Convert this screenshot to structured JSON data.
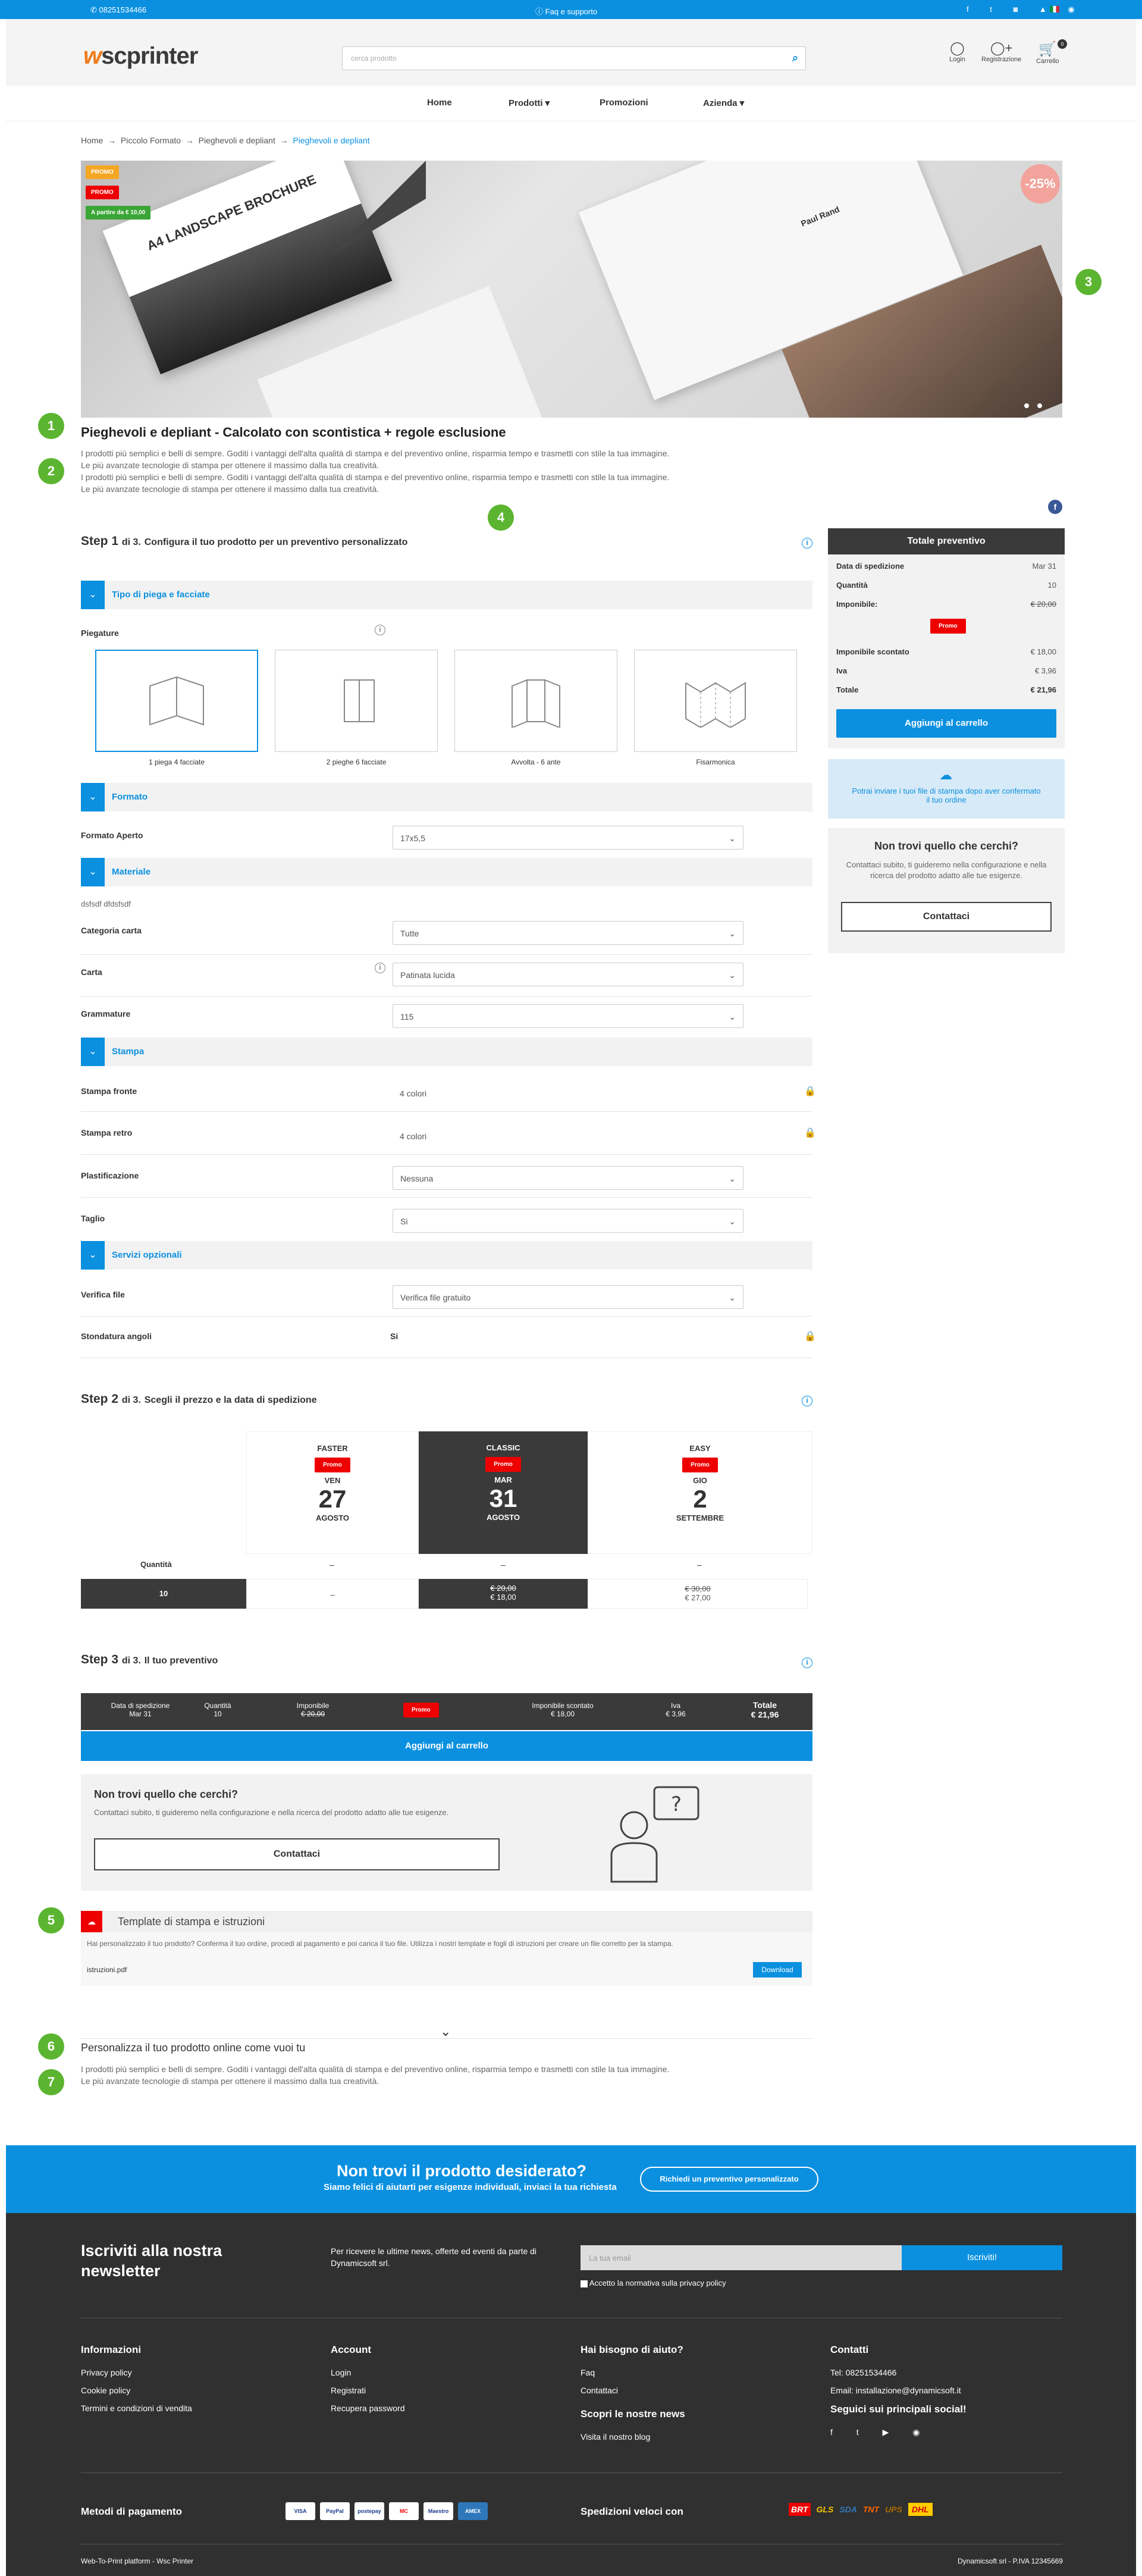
{
  "topbar": {
    "phone": "08251534466",
    "faq": "Faq e supporto"
  },
  "header": {
    "logo_prefix": "w",
    "logo_text": "scprinter",
    "search_placeholder": "cerca prodotto",
    "login": "Login",
    "register": "Registrazione",
    "cart": "Carrello",
    "cart_count": "0"
  },
  "nav": {
    "items": [
      "Home",
      "Prodotti",
      "Promozioni",
      "Azienda"
    ]
  },
  "breadcrumb": {
    "items": [
      "Home",
      "Piccolo Formato",
      "Pieghevoli e depliant"
    ],
    "current": "Pieghevoli e depliant"
  },
  "hero": {
    "badges": [
      "PROMO",
      "PROMO",
      "A partire da € 10,00"
    ],
    "discount": "-25%",
    "brochure_title": "A4 LANDSCAPE BROCHURE",
    "quote": "Paul Rand"
  },
  "markers": [
    "1",
    "2",
    "3",
    "4",
    "5",
    "6",
    "7"
  ],
  "product": {
    "title": "Pieghevoli e depliant - Calcolato con scontistica + regole esclusione",
    "desc_lines": [
      "I prodotti più semplici e belli di sempre. Goditi i vantaggi dell'alta qualità di stampa e del preventivo online, risparmia tempo e trasmetti con stile la tua immagine.",
      "Le più avanzate tecnologie di stampa per ottenere il massimo dalla tua creatività.",
      "I prodotti più semplici e belli di sempre. Goditi i vantaggi dell'alta qualità di stampa e del preventivo online, risparmia tempo e trasmetti con stile la tua immagine.",
      "Le più avanzate tecnologie di stampa per ottenere il massimo dalla tua creatività."
    ]
  },
  "step1": {
    "title": "Step 1",
    "of": "di 3.",
    "subtitle": "Configura il tuo prodotto per un preventivo personalizzato"
  },
  "sections": {
    "tipo": "Tipo di piega e facciate",
    "formato": "Formato",
    "materiale": "Materiale",
    "stampa": "Stampa",
    "servizi": "Servizi opzionali"
  },
  "config": {
    "piegature_label": "Piegature",
    "folds": [
      "1 piega 4 facciate",
      "2 pieghe 6 facciate",
      "Avvolta - 6 ante",
      "Fisarmonica"
    ],
    "formato_label": "Formato Aperto",
    "formato_value": "17x5,5",
    "materiale_note": "dsfsdf dfdsfsdf",
    "categoria_label": "Categoria carta",
    "categoria_value": "Tutte",
    "carta_label": "Carta",
    "carta_value": "Patinata lucida",
    "grammatura_label": "Grammature",
    "grammatura_value": "115",
    "fronte_label": "Stampa fronte",
    "fronte_value": "4 colori",
    "retro_label": "Stampa retro",
    "retro_value": "4 colori",
    "plast_label": "Plastificazione",
    "plast_value": "Nessuna",
    "taglio_label": "Taglio",
    "taglio_value": "Si",
    "verifica_label": "Verifica file",
    "verifica_value": "Verifica file gratuito",
    "stond_label": "Stondatura angoli",
    "stond_value": "Si"
  },
  "sidebar": {
    "total_title": "Totale preventivo",
    "rows": [
      {
        "k": "Data di spedizione",
        "v": "Mar 31"
      },
      {
        "k": "Quantità",
        "v": "10"
      },
      {
        "k": "Imponibile:",
        "v": "€ 20,00"
      }
    ],
    "promo": "Promo",
    "rows2": [
      {
        "k": "Imponibile scontato",
        "v": "€ 18,00"
      },
      {
        "k": "Iva",
        "v": "€ 3,96"
      },
      {
        "k": "Totale",
        "v": "€ 21,96"
      }
    ],
    "add_cart": "Aggiungi al carrello",
    "upload_text": "Potrai inviare i tuoi file di stampa dopo aver confermato il tuo ordine",
    "notfound_title": "Non trovi quello che cerchi?",
    "notfound_text": "Contattaci subito, ti guideremo nella configurazione e nella ricerca del prodotto adatto alle tue esigenze.",
    "contact": "Contattaci"
  },
  "step2": {
    "title": "Step 2",
    "of": "di 3.",
    "subtitle": "Scegli il prezzo e la data di spedizione",
    "cols": [
      {
        "name": "FASTER",
        "promo": "Promo",
        "day": "VEN",
        "num": "27",
        "month": "AGOSTO"
      },
      {
        "name": "CLASSIC",
        "promo": "Promo",
        "day": "MAR",
        "num": "31",
        "month": "AGOSTO"
      },
      {
        "name": "EASY",
        "promo": "Promo",
        "day": "GIO",
        "num": "2",
        "month": "SETTEMBRE"
      }
    ],
    "qty_label": "Quantità",
    "qty": "10",
    "dash": "–",
    "prices": [
      {
        "old": "",
        "new": "–"
      },
      {
        "old": "€ 20,00",
        "new": "€ 18,00"
      },
      {
        "old": "€ 30,00",
        "new": "€ 27,00"
      }
    ]
  },
  "step3": {
    "title": "Step 3",
    "of": "di 3.",
    "subtitle": "Il tuo preventivo",
    "headers": [
      "Data di spedizione",
      "Quantità",
      "Imponibile",
      "",
      "Imponibile scontato",
      "Iva",
      "Totale"
    ],
    "values": [
      "Mar 31",
      "10",
      "€ 20,00",
      "Promo",
      "€ 18,00",
      "€ 3,96",
      "€ 21,96"
    ],
    "add_cart": "Aggiungi al carrello",
    "notfound_title": "Non trovi quello che cerchi?",
    "notfound_text": "Contattaci subito, ti guideremo nella configurazione e nella ricerca del prodotto adatto alle tue esigenze.",
    "contact": "Contattaci"
  },
  "templates": {
    "title": "Template di stampa e istruzioni",
    "text": "Hai personalizzato il tuo prodotto? Conferma il tuo ordine, procedi al pagamento e poi carica il tuo file. Utilizza i nostri template e fogli di istruzioni per creare un file corretto per la stampa.",
    "file": "istruzioni.pdf",
    "download": "Download"
  },
  "personalize": {
    "title": "Personalizza il tuo prodotto online come vuoi tu",
    "lines": [
      "I prodotti più semplici e belli di sempre. Goditi i vantaggi dell'alta qualità di stampa e del preventivo online, risparmia tempo e trasmetti con stile la tua immagine.",
      "Le più avanzate tecnologie di stampa per ottenere il massimo dalla tua creatività."
    ]
  },
  "cta": {
    "title": "Non trovi il prodotto desiderato?",
    "sub": "Siamo felici di aiutarti per esigenze individuali, inviaci la tua richiesta",
    "button": "Richiedi un preventivo personalizzato"
  },
  "newsletter": {
    "title": "Iscriviti alla nostra newsletter",
    "text": "Per ricevere le ultime news, offerte ed eventi da parte di Dynamicsoft srl.",
    "placeholder": "La tua email",
    "button": "Iscriviti!",
    "privacy": "Accetto la normativa sulla privacy policy"
  },
  "footer": {
    "cols": [
      {
        "title": "Informazioni",
        "items": [
          "Privacy policy",
          "Cookie policy",
          "Termini e condizioni di vendita"
        ]
      },
      {
        "title": "Account",
        "items": [
          "Login",
          "Registrati",
          "Recupera password"
        ]
      },
      {
        "title": "Hai bisogno di aiuto?",
        "items": [
          "Faq",
          "Contattaci"
        ]
      },
      {
        "title": "Contatti",
        "items": [
          "Tel: 08251534466",
          "Email: installazione@dynamicsoft.it"
        ]
      }
    ],
    "blog_title": "Scopri le nostre news",
    "blog_link": "Visita il nostro blog",
    "social_title": "Seguici sui principali social!",
    "payments_title": "Metodi di pagamento",
    "payments": [
      "VISA",
      "PayPal",
      "postepay",
      "MC",
      "Maestro",
      "AMEX"
    ],
    "shipping_title": "Spedizioni veloci con",
    "carriers": [
      "BRT",
      "GLS",
      "SDA",
      "TNT",
      "UPS",
      "DHL"
    ],
    "bottom_left": "Web-To-Print platform - Wsc Printer",
    "bottom_right": "Dynamicsoft srl - P.IVA 12345669"
  },
  "colors": {
    "accent": "#0b90e0",
    "green": "#5cb530",
    "promo": "#e00000",
    "dark": "#3a3a3a"
  }
}
